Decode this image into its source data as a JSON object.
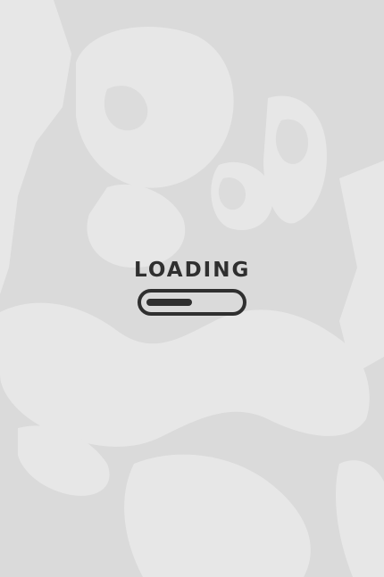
{
  "loader": {
    "label": "LOADING",
    "progress_fraction": 0.5
  },
  "colors": {
    "background": "#dadada",
    "artwork": "#e9e9e9",
    "foreground": "#2f2f2f"
  },
  "icons": {
    "background_art": "band-poster-artwork"
  }
}
